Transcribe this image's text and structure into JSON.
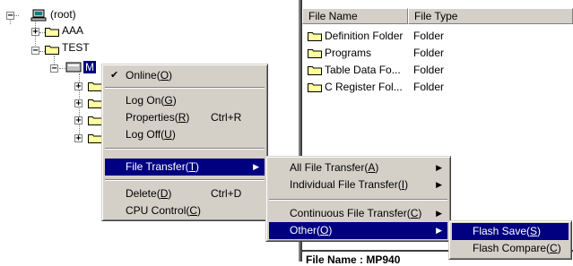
{
  "tree": {
    "root_label": "(root)",
    "node_aaa": "AAA",
    "node_test": "TEST",
    "node_selected": "M"
  },
  "list": {
    "headers": [
      "File Name",
      "File Type"
    ],
    "rows": [
      {
        "name": "Definition Folder",
        "type": "Folder"
      },
      {
        "name": "Programs",
        "type": "Folder"
      },
      {
        "name": "Table Data Fo...",
        "type": "Folder"
      },
      {
        "name": "C Register Fol...",
        "type": "Folder"
      }
    ],
    "footer_text": "File Name : MP940"
  },
  "context_menu": {
    "online": {
      "label": "Online(",
      "key": "O",
      "end": ")",
      "checked": true
    },
    "logon": {
      "label": "Log On(",
      "key": "G",
      "end": ")"
    },
    "properties": {
      "label": "Properties(",
      "key": "R",
      "end": ")",
      "shortcut": "Ctrl+R"
    },
    "logoff": {
      "label": "Log Off(",
      "key": "U",
      "end": ")"
    },
    "file_transfer": {
      "label": "File Transfer(",
      "key": "T",
      "end": ")"
    },
    "delete": {
      "label": "Delete(",
      "key": "D",
      "end": ")",
      "shortcut": "Ctrl+D"
    },
    "cpu_control": {
      "label": "CPU Control(",
      "key": "C",
      "end": ")"
    }
  },
  "transfer_menu": {
    "all": {
      "label": "All File Transfer(",
      "key": "A",
      "end": ")"
    },
    "individual": {
      "label": "Individual File Transfer(",
      "key": "I",
      "end": ")"
    },
    "continuous": {
      "label": "Continuous File Transfer(",
      "key": "C",
      "end": ")"
    },
    "other": {
      "label": "Other(",
      "key": "O",
      "end": ")"
    }
  },
  "other_menu": {
    "flash_save": {
      "label": "Flash Save(",
      "key": "S",
      "end": ")"
    },
    "flash_compare": {
      "label": "Flash Compare(",
      "key": "C",
      "end": ")"
    }
  },
  "colors": {
    "highlight": "#000080",
    "menu_bg": "#d4d0c8",
    "folder": "#ffffa0"
  },
  "icons": [
    "computer-icon",
    "folder-icon",
    "checkmark-icon",
    "submenu-arrow-icon",
    "expand-plus-icon",
    "collapse-minus-icon"
  ]
}
